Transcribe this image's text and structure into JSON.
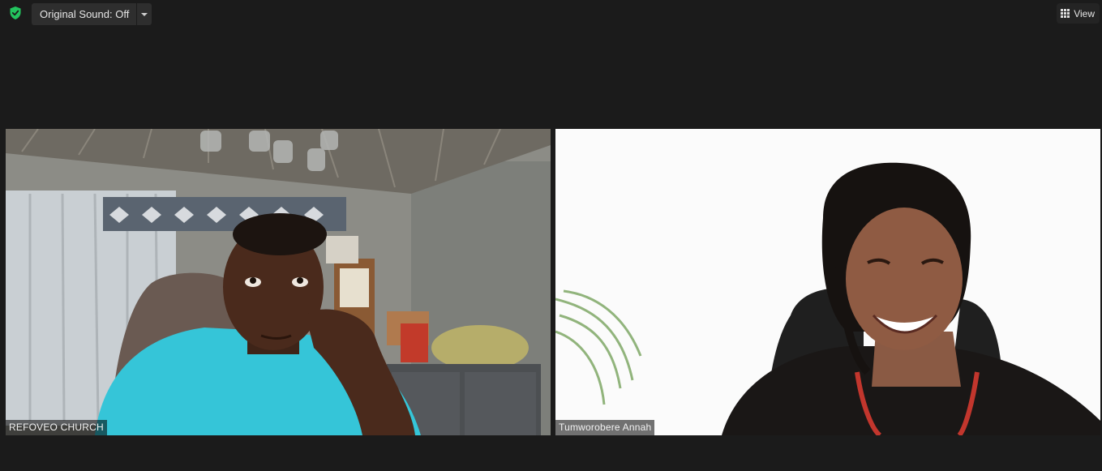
{
  "toolbar": {
    "original_sound_label": "Original Sound: Off",
    "view_label": "View"
  },
  "icons": {
    "security": "shield-check-icon",
    "sound_menu": "chevron-down-icon",
    "view": "grid-icon"
  },
  "participants": [
    {
      "name": "REFOVEO CHURCH"
    },
    {
      "name": "Tumworobere Annah"
    }
  ],
  "colors": {
    "background": "#1b1b1b",
    "shield": "#23c45e",
    "button": "#2e2e2e"
  }
}
